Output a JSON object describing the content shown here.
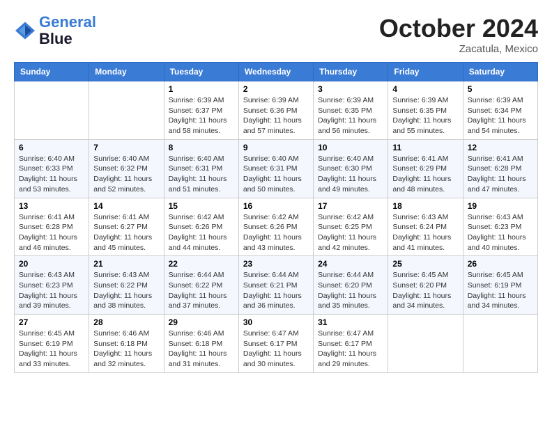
{
  "header": {
    "logo_line1": "General",
    "logo_line2": "Blue",
    "month": "October 2024",
    "location": "Zacatula, Mexico"
  },
  "days_of_week": [
    "Sunday",
    "Monday",
    "Tuesday",
    "Wednesday",
    "Thursday",
    "Friday",
    "Saturday"
  ],
  "weeks": [
    [
      {
        "day": "",
        "info": ""
      },
      {
        "day": "",
        "info": ""
      },
      {
        "day": "1",
        "info": "Sunrise: 6:39 AM\nSunset: 6:37 PM\nDaylight: 11 hours\nand 58 minutes."
      },
      {
        "day": "2",
        "info": "Sunrise: 6:39 AM\nSunset: 6:36 PM\nDaylight: 11 hours\nand 57 minutes."
      },
      {
        "day": "3",
        "info": "Sunrise: 6:39 AM\nSunset: 6:35 PM\nDaylight: 11 hours\nand 56 minutes."
      },
      {
        "day": "4",
        "info": "Sunrise: 6:39 AM\nSunset: 6:35 PM\nDaylight: 11 hours\nand 55 minutes."
      },
      {
        "day": "5",
        "info": "Sunrise: 6:39 AM\nSunset: 6:34 PM\nDaylight: 11 hours\nand 54 minutes."
      }
    ],
    [
      {
        "day": "6",
        "info": "Sunrise: 6:40 AM\nSunset: 6:33 PM\nDaylight: 11 hours\nand 53 minutes."
      },
      {
        "day": "7",
        "info": "Sunrise: 6:40 AM\nSunset: 6:32 PM\nDaylight: 11 hours\nand 52 minutes."
      },
      {
        "day": "8",
        "info": "Sunrise: 6:40 AM\nSunset: 6:31 PM\nDaylight: 11 hours\nand 51 minutes."
      },
      {
        "day": "9",
        "info": "Sunrise: 6:40 AM\nSunset: 6:31 PM\nDaylight: 11 hours\nand 50 minutes."
      },
      {
        "day": "10",
        "info": "Sunrise: 6:40 AM\nSunset: 6:30 PM\nDaylight: 11 hours\nand 49 minutes."
      },
      {
        "day": "11",
        "info": "Sunrise: 6:41 AM\nSunset: 6:29 PM\nDaylight: 11 hours\nand 48 minutes."
      },
      {
        "day": "12",
        "info": "Sunrise: 6:41 AM\nSunset: 6:28 PM\nDaylight: 11 hours\nand 47 minutes."
      }
    ],
    [
      {
        "day": "13",
        "info": "Sunrise: 6:41 AM\nSunset: 6:28 PM\nDaylight: 11 hours\nand 46 minutes."
      },
      {
        "day": "14",
        "info": "Sunrise: 6:41 AM\nSunset: 6:27 PM\nDaylight: 11 hours\nand 45 minutes."
      },
      {
        "day": "15",
        "info": "Sunrise: 6:42 AM\nSunset: 6:26 PM\nDaylight: 11 hours\nand 44 minutes."
      },
      {
        "day": "16",
        "info": "Sunrise: 6:42 AM\nSunset: 6:26 PM\nDaylight: 11 hours\nand 43 minutes."
      },
      {
        "day": "17",
        "info": "Sunrise: 6:42 AM\nSunset: 6:25 PM\nDaylight: 11 hours\nand 42 minutes."
      },
      {
        "day": "18",
        "info": "Sunrise: 6:43 AM\nSunset: 6:24 PM\nDaylight: 11 hours\nand 41 minutes."
      },
      {
        "day": "19",
        "info": "Sunrise: 6:43 AM\nSunset: 6:23 PM\nDaylight: 11 hours\nand 40 minutes."
      }
    ],
    [
      {
        "day": "20",
        "info": "Sunrise: 6:43 AM\nSunset: 6:23 PM\nDaylight: 11 hours\nand 39 minutes."
      },
      {
        "day": "21",
        "info": "Sunrise: 6:43 AM\nSunset: 6:22 PM\nDaylight: 11 hours\nand 38 minutes."
      },
      {
        "day": "22",
        "info": "Sunrise: 6:44 AM\nSunset: 6:22 PM\nDaylight: 11 hours\nand 37 minutes."
      },
      {
        "day": "23",
        "info": "Sunrise: 6:44 AM\nSunset: 6:21 PM\nDaylight: 11 hours\nand 36 minutes."
      },
      {
        "day": "24",
        "info": "Sunrise: 6:44 AM\nSunset: 6:20 PM\nDaylight: 11 hours\nand 35 minutes."
      },
      {
        "day": "25",
        "info": "Sunrise: 6:45 AM\nSunset: 6:20 PM\nDaylight: 11 hours\nand 34 minutes."
      },
      {
        "day": "26",
        "info": "Sunrise: 6:45 AM\nSunset: 6:19 PM\nDaylight: 11 hours\nand 34 minutes."
      }
    ],
    [
      {
        "day": "27",
        "info": "Sunrise: 6:45 AM\nSunset: 6:19 PM\nDaylight: 11 hours\nand 33 minutes."
      },
      {
        "day": "28",
        "info": "Sunrise: 6:46 AM\nSunset: 6:18 PM\nDaylight: 11 hours\nand 32 minutes."
      },
      {
        "day": "29",
        "info": "Sunrise: 6:46 AM\nSunset: 6:18 PM\nDaylight: 11 hours\nand 31 minutes."
      },
      {
        "day": "30",
        "info": "Sunrise: 6:47 AM\nSunset: 6:17 PM\nDaylight: 11 hours\nand 30 minutes."
      },
      {
        "day": "31",
        "info": "Sunrise: 6:47 AM\nSunset: 6:17 PM\nDaylight: 11 hours\nand 29 minutes."
      },
      {
        "day": "",
        "info": ""
      },
      {
        "day": "",
        "info": ""
      }
    ]
  ]
}
